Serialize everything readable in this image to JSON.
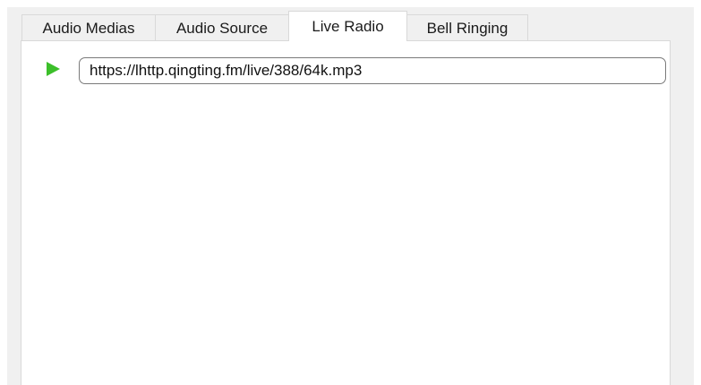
{
  "tabs": [
    {
      "label": "Audio Medias",
      "active": false
    },
    {
      "label": "Audio Source",
      "active": false
    },
    {
      "label": "Live Radio",
      "active": true
    },
    {
      "label": "Bell Ringing",
      "active": false
    }
  ],
  "live_radio": {
    "play_icon": "play-icon",
    "url_value": "https://lhttp.qingting.fm/live/388/64k.mp3"
  },
  "colors": {
    "play": "#3cbf2a",
    "tab_border": "#d9d9d9",
    "background": "#f0f0f0"
  }
}
